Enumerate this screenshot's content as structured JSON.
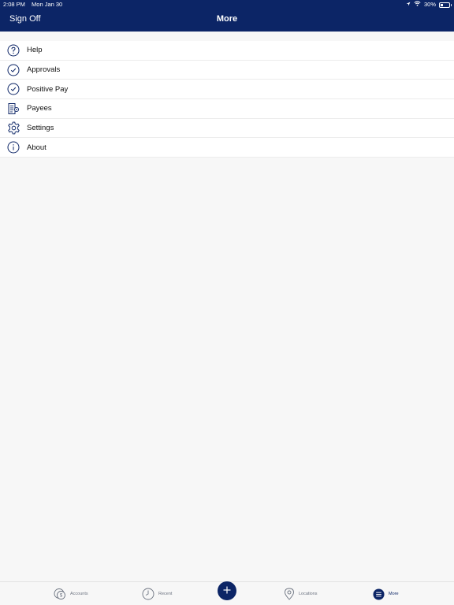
{
  "status_bar": {
    "time": "2:08 PM",
    "date": "Mon Jan 30",
    "battery": "30%",
    "icons": [
      "location-icon",
      "wifi-icon",
      "battery-icon"
    ]
  },
  "navbar": {
    "title": "More",
    "sign_off_label": "Sign Off"
  },
  "menu": {
    "items": [
      {
        "label": "Help",
        "icon": "question-icon"
      },
      {
        "label": "Approvals",
        "icon": "check-circle-icon"
      },
      {
        "label": "Positive Pay",
        "icon": "check-circle-icon"
      },
      {
        "label": "Payees",
        "icon": "payees-icon"
      },
      {
        "label": "Settings",
        "icon": "gear-icon"
      },
      {
        "label": "About",
        "icon": "info-icon"
      }
    ]
  },
  "tabbar": {
    "items": [
      {
        "label": "Accounts",
        "icon": "accounts-icon",
        "active": false
      },
      {
        "label": "Recent",
        "icon": "clock-icon",
        "active": false
      },
      {
        "label": "Locations",
        "icon": "map-pin-icon",
        "active": false
      },
      {
        "label": "More",
        "icon": "menu-icon",
        "active": true
      }
    ],
    "add_icon": "plus-icon"
  },
  "colors": {
    "brand": "#0c2566",
    "background": "#f7f7f7",
    "tab_inactive": "#6c7380"
  }
}
